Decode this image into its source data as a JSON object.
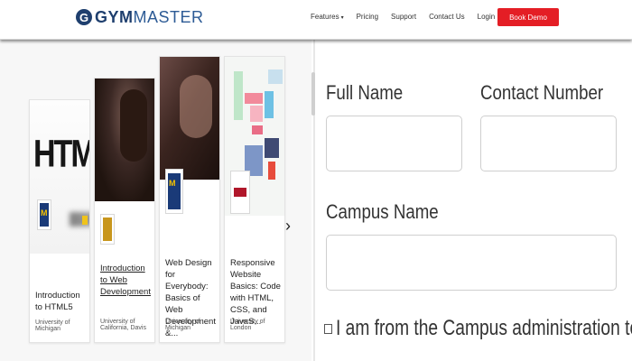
{
  "header": {
    "logo_letter": "G",
    "logo_bold": "GYM",
    "logo_light": "MASTER",
    "nav": [
      {
        "label": "Features",
        "caret": "▾"
      },
      {
        "label": "Pricing"
      },
      {
        "label": "Support"
      },
      {
        "label": "Contact Us"
      },
      {
        "label": "Login"
      }
    ],
    "cta_label": "Book Demo",
    "colors": {
      "brand": "#1f3f6e",
      "cta": "#e41e25"
    }
  },
  "carousel": {
    "cards": [
      {
        "thumb_text": "HTML",
        "title": "Introduction to HTML5",
        "org": "University of Michigan",
        "underline": false
      },
      {
        "title": "Introduction to Web Development",
        "org": "University of California, Davis",
        "underline": true
      },
      {
        "title": "Web Design for Everybody: Basics of Web Development &...",
        "org": "University of Michigan",
        "underline": false
      },
      {
        "title": "Responsive Website Basics: Code with HTML, CSS, and JavaS...",
        "org": "University of London",
        "underline": false
      }
    ],
    "next_icon": "›"
  },
  "form": {
    "full_name_label": "Full Name",
    "contact_number_label": "Contact Number",
    "campus_name_label": "Campus Name",
    "admin_checkbox_label": "I am from the Campus administration team",
    "admin_checkbox_checked": false
  }
}
